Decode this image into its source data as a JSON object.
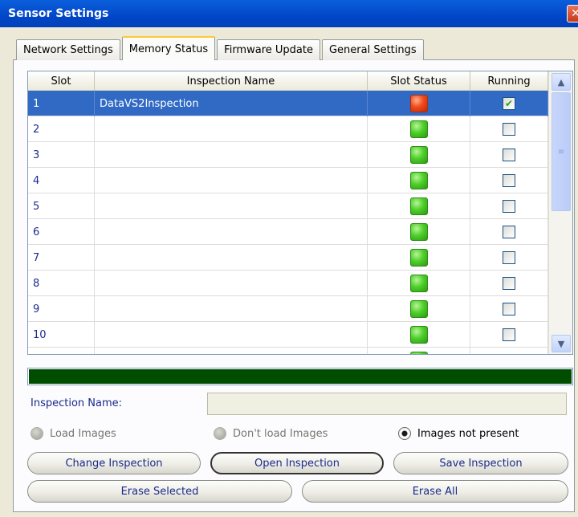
{
  "window": {
    "title": "Sensor Settings",
    "close_glyph": "✕"
  },
  "tabs": [
    {
      "label": "Network Settings",
      "active": false
    },
    {
      "label": "Memory Status",
      "active": true
    },
    {
      "label": "Firmware Update",
      "active": false
    },
    {
      "label": "General Settings",
      "active": false
    }
  ],
  "grid": {
    "columns": [
      "Slot",
      "Inspection Name",
      "Slot Status",
      "Running"
    ],
    "rows": [
      {
        "slot": "1",
        "name": "DataVS2Inspection",
        "status": "red",
        "running": true,
        "selected": true
      },
      {
        "slot": "2",
        "name": "",
        "status": "green",
        "running": false,
        "selected": false
      },
      {
        "slot": "3",
        "name": "",
        "status": "green",
        "running": false,
        "selected": false
      },
      {
        "slot": "4",
        "name": "",
        "status": "green",
        "running": false,
        "selected": false
      },
      {
        "slot": "5",
        "name": "",
        "status": "green",
        "running": false,
        "selected": false
      },
      {
        "slot": "6",
        "name": "",
        "status": "green",
        "running": false,
        "selected": false
      },
      {
        "slot": "7",
        "name": "",
        "status": "green",
        "running": false,
        "selected": false
      },
      {
        "slot": "8",
        "name": "",
        "status": "green",
        "running": false,
        "selected": false
      },
      {
        "slot": "9",
        "name": "",
        "status": "green",
        "running": false,
        "selected": false
      },
      {
        "slot": "10",
        "name": "",
        "status": "green",
        "running": false,
        "selected": false
      },
      {
        "slot": "",
        "name": "",
        "status": "green",
        "running": false,
        "selected": false
      }
    ],
    "status_colors": {
      "green": "#4fd02a",
      "red": "#f24a1a"
    },
    "selected_row_color": "#316ac5"
  },
  "progress": {
    "fraction": 1.0,
    "color": "#004d00"
  },
  "inspection_name": {
    "label": "Inspection Name:",
    "value": ""
  },
  "image_options": [
    {
      "label": "Load Images",
      "checked": false
    },
    {
      "label": "Don't load Images",
      "checked": false
    },
    {
      "label": "Images not present",
      "checked": true
    }
  ],
  "buttons": {
    "change_inspection": "Change Inspection",
    "open_inspection": "Open Inspection",
    "save_inspection": "Save Inspection",
    "erase_selected": "Erase Selected",
    "erase_all": "Erase All"
  },
  "icons": {
    "check": "✔",
    "arrow_up": "▲",
    "arrow_down": "▼",
    "grip": "≡"
  }
}
